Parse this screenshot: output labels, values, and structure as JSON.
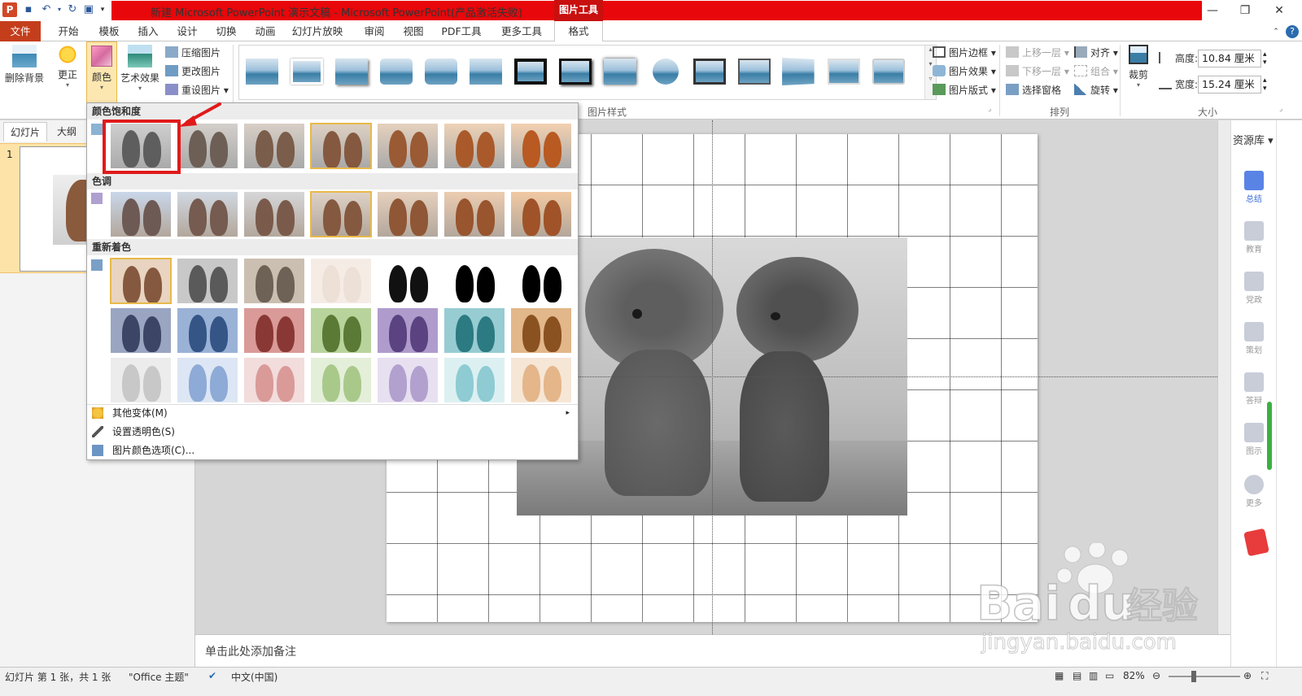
{
  "titlebar": {
    "title": "新建 Microsoft PowerPoint 演示文稿 - Microsoft PowerPoint(产品激活失败)",
    "tool_context": "图片工具",
    "app_letter": "P"
  },
  "tabs": {
    "file": "文件",
    "items": [
      "开始",
      "模板",
      "插入",
      "设计",
      "切换",
      "动画",
      "幻灯片放映",
      "审阅",
      "视图",
      "PDF工具",
      "更多工具"
    ],
    "format": "格式"
  },
  "ribbon": {
    "remove_bg": "删除背景",
    "correct": "更正",
    "color": "颜色",
    "art_effects": "艺术效果",
    "compress": "压缩图片",
    "change_pic": "更改图片",
    "reset_pic": "重设图片",
    "picture_styles_label": "图片样式",
    "border": "图片边框",
    "effects": "图片效果",
    "layout": "图片版式",
    "bring_forward": "上移一层",
    "send_backward": "下移一层",
    "selection_pane": "选择窗格",
    "align": "对齐",
    "group": "组合",
    "rotate": "旋转",
    "arrange_label": "排列",
    "crop": "裁剪",
    "height_label": "高度:",
    "height_value": "10.84 厘米",
    "width_label": "宽度:",
    "width_value": "15.24 厘米",
    "size_label": "大小"
  },
  "color_menu": {
    "saturation_title": "颜色饱和度",
    "tone_title": "色调",
    "recolor_title": "重新着色",
    "more_variations": "其他变体(M)",
    "set_transparent": "设置透明色(S)",
    "color_options": "图片颜色选项(C)..."
  },
  "left_panel": {
    "tab_slides": "幻灯片",
    "tab_outline": "大纲",
    "slide_number": "1"
  },
  "notes": {
    "placeholder": "单击此处添加备注"
  },
  "right_panel": {
    "header": "资源库",
    "items": [
      "总结",
      "教育",
      "党政",
      "策划",
      "答辩",
      "图示",
      "更多"
    ]
  },
  "status": {
    "slide_info": "幻灯片 第 1 张，共 1 张",
    "theme": "\"Office 主题\"",
    "language": "中文(中国)",
    "zoom": "82%"
  },
  "watermark": {
    "brand": "Bai",
    "brand2": "du",
    "suffix": "经验",
    "url": "jingyan.baidu.com"
  },
  "colors": {
    "file_tab": "#c43e1c",
    "title_red": "#e8070a",
    "selected_border": "#e8b94a",
    "highlight_red": "#e01a1a"
  }
}
